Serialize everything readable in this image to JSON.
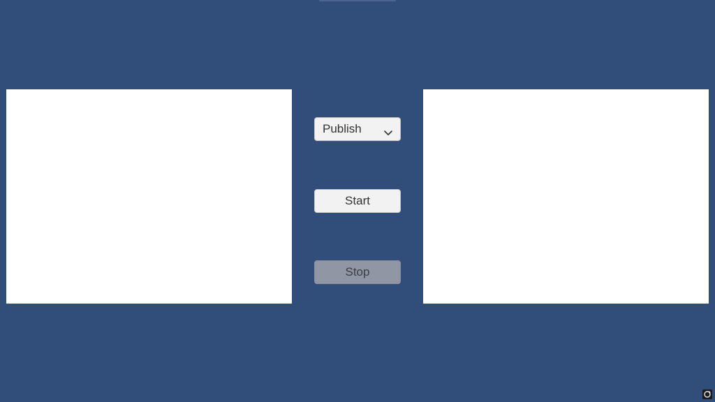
{
  "controls": {
    "mode_dropdown": {
      "selected": "Publish"
    },
    "start_label": "Start",
    "stop_label": "Stop"
  },
  "icons": {
    "dropdown": "chevron-down-icon",
    "corner": "reload-icon"
  },
  "colors": {
    "background": "#314d79",
    "panel": "#ffffff",
    "button": "#f2f2f2",
    "button_disabled": "#9196a4"
  }
}
